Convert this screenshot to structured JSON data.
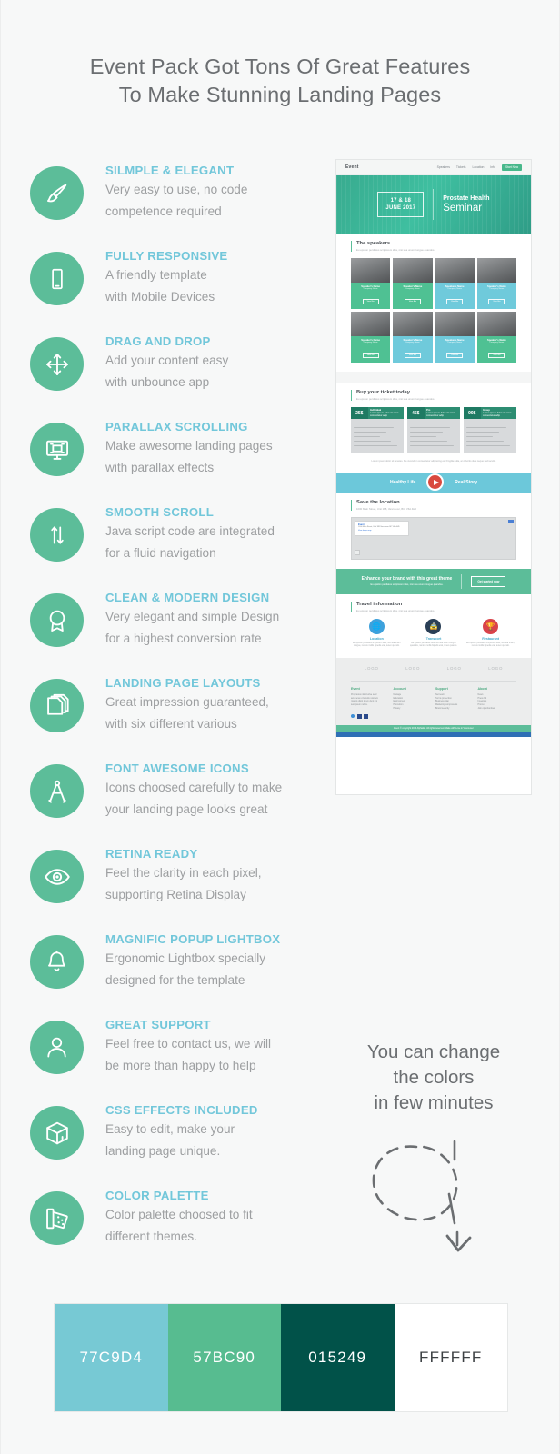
{
  "title": {
    "line1": "Event Pack Got Tons Of Great Features",
    "line2": "To Make Stunning Landing Pages"
  },
  "features": [
    {
      "icon": "paintbrush-icon",
      "title": "SILMPLE & ELEGANT",
      "desc_line1": "Very easy to use, no code",
      "desc_line2": "competence required"
    },
    {
      "icon": "mobile-phone-icon",
      "title": "FULLY RESPONSIVE",
      "desc_line1": "A friendly template",
      "desc_line2": "with Mobile Devices"
    },
    {
      "icon": "move-arrows-icon",
      "title": "DRAG AND DROP",
      "desc_line1": "Add your content easy",
      "desc_line2": "with unbounce app"
    },
    {
      "icon": "monitor-icon",
      "title": "PARALLAX SCROLLING",
      "desc_line1": "Make awesome landing pages",
      "desc_line2": "with parallax effects"
    },
    {
      "icon": "up-down-arrows-icon",
      "title": "SMOOTH SCROLL",
      "desc_line1": "Java script code are integrated",
      "desc_line2": "for a fluid navigation"
    },
    {
      "icon": "award-ribbon-icon",
      "title": "CLEAN & MODERN DESIGN",
      "desc_line1": "Very elegant and simple Design",
      "desc_line2": "for a highest conversion rate"
    },
    {
      "icon": "stacked-pages-icon",
      "title": "LANDING PAGE LAYOUTS",
      "desc_line1": "Great impression guaranteed,",
      "desc_line2": "with six different various"
    },
    {
      "icon": "compass-divider-icon",
      "title": "FONT AWESOME ICONS",
      "desc_line1": "Icons choosed carefully to make",
      "desc_line2": "your landing page looks great"
    },
    {
      "icon": "eye-icon",
      "title": "RETINA READY",
      "desc_line1": "Feel the clarity in each pixel,",
      "desc_line2": "supporting Retina Display"
    },
    {
      "icon": "bell-icon",
      "title": "MAGNIFIC POPUP LIGHTBOX",
      "desc_line1": "Ergonomic Lightbox specially",
      "desc_line2": "designed for the template"
    },
    {
      "icon": "user-icon",
      "title": "GREAT SUPPORT",
      "desc_line1": "Feel free to contact us, we will",
      "desc_line2": "be more than happy to help"
    },
    {
      "icon": "box-cube-icon",
      "title": "CSS EFFECTS INCLUDED",
      "desc_line1": "Easy to edit, make your",
      "desc_line2": "landing page unique."
    },
    {
      "icon": "color-swatch-icon",
      "title": "COLOR PALETTE",
      "desc_line1": "Color palette choosed to fit",
      "desc_line2": "different themes."
    }
  ],
  "mockup": {
    "logo": "Event",
    "nav": [
      "Speakers",
      "Tickets",
      "Location",
      "Info"
    ],
    "nav_button": "Start Now",
    "hero": {
      "date_line1": "17 & 18",
      "date_line2": "JUNE 2017",
      "title_small": "Prostate Health",
      "title_large": "Seminar"
    },
    "speakers": {
      "heading": "The speakers",
      "sub": "Eu epsilon perdiatus scriptorem ides, nisi sea unum congue quandos.",
      "cards": [
        {
          "name": "Speaker's Name",
          "company": "Company Name",
          "button": "View Bio",
          "tone": "g"
        },
        {
          "name": "Speaker's Name",
          "company": "Company Name",
          "button": "View Bio",
          "tone": "g"
        },
        {
          "name": "Speaker's Name",
          "company": "Company Name",
          "button": "View Bio",
          "tone": "b"
        },
        {
          "name": "Speaker's Name",
          "company": "Company Name",
          "button": "View Bio",
          "tone": "b"
        },
        {
          "name": "Speaker's Name",
          "company": "Company Name",
          "button": "View Bio",
          "tone": "g"
        },
        {
          "name": "Speaker's Name",
          "company": "Company Name",
          "button": "View Bio",
          "tone": "b"
        },
        {
          "name": "Speaker's Name",
          "company": "Company Name",
          "button": "View Bio",
          "tone": "b"
        },
        {
          "name": "Speaker's Name",
          "company": "Company Name",
          "button": "View Bio",
          "tone": "g"
        }
      ]
    },
    "tickets": {
      "heading": "Buy your ticket today",
      "sub": "Eu epsilon perdiatus scriptorem ides, nisi sea unum congue quandos.",
      "plans": [
        {
          "price": "25$",
          "name": "Individual",
          "note": "Lorem ipsum dolor sit amet consectetur adip"
        },
        {
          "price": "45$",
          "name": "Pro",
          "note": "Lorem ipsum dolor sit amet consectetur adip"
        },
        {
          "price": "99$",
          "name": "Group",
          "note": "Lorem ipsum dolor sit amet consectetur adip"
        }
      ],
      "legal": "Lorem ipsum dolor sit ametes. Me vivendum consectetur adipiscing est fringilla nulla, an lobortis duis neque sed iaculis."
    },
    "video": {
      "left": "Healthy Life",
      "right": "Real Story",
      "play": "play-button"
    },
    "location": {
      "heading": "Save the location",
      "sub": "1000 Main Street, Unit 188, Vancouver, BC, V6A 4H5",
      "map_card_title": "Event",
      "map_card_sub": "1000 Main Street, Unit 188 Vancouver BC V6A 4H5",
      "map_card_link": "View larger map"
    },
    "cta": {
      "heading": "Enhance your brand with this great theme",
      "sub": "Eu epsilon perdiatus scriptorem ides, nisi sea unum congue quandos.",
      "button": "Get started now"
    },
    "travel": {
      "heading": "Travel information",
      "sub": "Eu epsilon perdiatus scriptorem ides, nisi sea unum congue quandos.",
      "items": [
        {
          "icon": "globe-icon",
          "name": "Location",
          "desc": "Eu epsilon perdiatus scriptorem ides, nisi sea unum congue, nuntos mollis bipedis erat, tenen quando."
        },
        {
          "icon": "taxi-icon",
          "name": "Transport",
          "desc": "Eu epsilon perdiatus ides, nisi sea unum congue quandos, nuntos mollis bipedis erat, tenen quando."
        },
        {
          "icon": "trophy-icon",
          "name": "Restaurant",
          "desc": "Eu epsilon perdiatus scriptorem ides, nisi sea unum, nuntos mollis bipedis erat, tenen quando."
        }
      ]
    },
    "logos": [
      "LOGO",
      "LOGO",
      "LOGO",
      "LOGO"
    ],
    "footer": {
      "columns": [
        {
          "head": "Event",
          "items": [
            "Proprietus nisi involve seid",
            "acumena ut lurcutis nostrem",
            "nivanis dispt lorem dunt uni",
            "test ipsum nullos."
          ]
        },
        {
          "head": "Account",
          "items": [
            "Manage",
            "Education",
            "Environment",
            "Promotion",
            "Privacy"
          ]
        },
        {
          "head": "Support",
          "items": [
            "Net tearn",
            "Terms protection",
            "Business plan",
            "Marketing components",
            "Brand security"
          ]
        },
        {
          "head": "About",
          "items": [
            "News",
            "Press Kit",
            "Investors",
            "Promo",
            "Join opportunities"
          ]
        }
      ],
      "copyright": "Event © copyright 2016 Alphatite. All rights reserved. Made with Love in Vancouver"
    }
  },
  "caption": {
    "line1": "You can change",
    "line2": "the colors",
    "line3": "in few minutes"
  },
  "palette": {
    "swatches": [
      {
        "hex": "77C9D4",
        "label": "77C9D4"
      },
      {
        "hex": "57BC90",
        "label": "57BC90"
      },
      {
        "hex": "015249",
        "label": "015249"
      },
      {
        "hex": "FFFFFF",
        "label": "FFFFFF"
      }
    ]
  },
  "colors": {
    "accent_green": "#5cbd99",
    "accent_blue": "#72c7da",
    "title_gray": "#6b6e71",
    "body_gray": "#9d9fa1",
    "background": "#f7f8f8"
  }
}
